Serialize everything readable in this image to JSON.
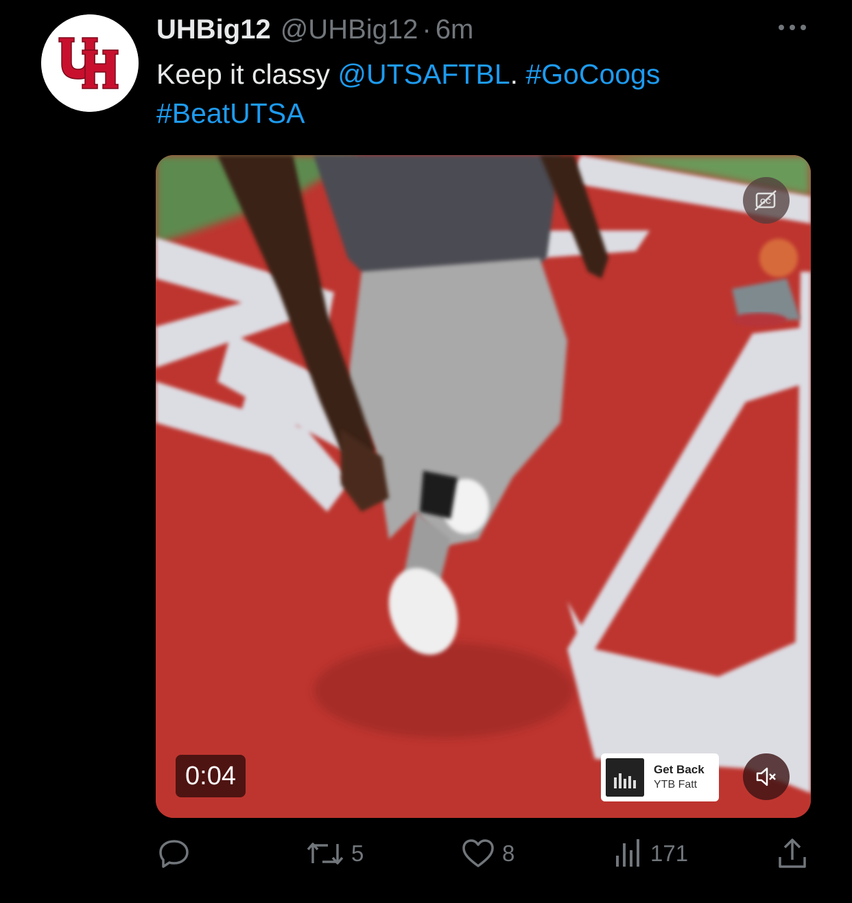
{
  "tweet": {
    "display_name": "UHBig12",
    "handle": "@UHBig12",
    "separator": "·",
    "time": "6m",
    "text_part1": "Keep it classy ",
    "mention": "@UTSAFTBL",
    "text_part2": ". ",
    "hashtag1": "#GoCoogs",
    "hashtag2": "#BeatUTSA",
    "avatar_icon": "uh-logo-icon",
    "more_icon": "more-options-icon"
  },
  "video": {
    "timestamp": "0:04",
    "music_song": "Get Back",
    "music_artist": "YTB Fatt",
    "cc_icon": "captions-off-icon",
    "mute_icon": "speaker-muted-icon"
  },
  "actions": {
    "reply_count": "",
    "retweet_count": "5",
    "like_count": "8",
    "views_count": "171"
  },
  "colors": {
    "background": "#000000",
    "text": "#e7e9ea",
    "muted": "#71767b",
    "link": "#1d9bf0",
    "brand_red": "#c8102e"
  }
}
